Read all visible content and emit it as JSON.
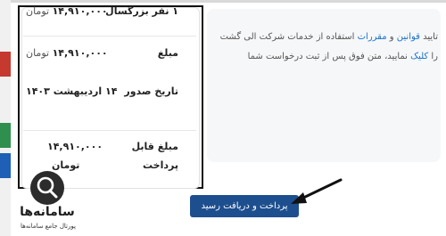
{
  "summary": {
    "rows": [
      {
        "label": "۱ نفر بزرگسال",
        "amount": "۱۴,۹۱۰,۰۰۰",
        "unit": "تومان"
      },
      {
        "label": "مبلغ",
        "amount": "۱۴,۹۱۰,۰۰۰",
        "unit": "تومان"
      },
      {
        "label": "تاریخ صدور",
        "value": "۱۴ اردیبهشت ۱۴۰۳"
      }
    ],
    "payable_label_1": "مبلغ قابل",
    "payable_label_2": "پرداخت",
    "payable_amount": "۱۴,۹۱۰,۰۰۰",
    "payable_unit": "تومان"
  },
  "terms": {
    "line1_pre": "تایید ",
    "line1_link1": "قوانین",
    "line1_mid": " و ",
    "line1_link2": "مقررات",
    "line1_post": " استفاده از خدمات شرکت الی گشت",
    "line2_pre": "را ",
    "line2_link": "کلیک",
    "line2_post": " نمایید، متن فوق پس از ثبت درخواست شما"
  },
  "pay_button_label": "پرداخت و دریافت رسید",
  "watermark": {
    "title": "سامانه‌ها",
    "subtitle": "پورتال جامع سامانه‌ها"
  }
}
